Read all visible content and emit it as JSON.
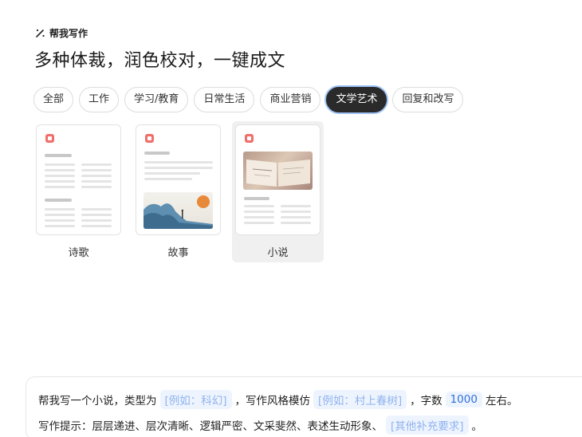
{
  "header": {
    "badge_label": "帮我写作",
    "title": "多种体裁，润色校对，一键成文",
    "badge_icon": "magic-wand-icon"
  },
  "tabs": [
    {
      "label": "全部",
      "active": false
    },
    {
      "label": "工作",
      "active": false
    },
    {
      "label": "学习/教育",
      "active": false
    },
    {
      "label": "日常生活",
      "active": false
    },
    {
      "label": "商业营销",
      "active": false
    },
    {
      "label": "文学艺术",
      "active": true
    },
    {
      "label": "回复和改写",
      "active": false
    }
  ],
  "cards": [
    {
      "label": "诗歌",
      "selected": false
    },
    {
      "label": "故事",
      "selected": false
    },
    {
      "label": "小说",
      "selected": true
    }
  ],
  "prompt": {
    "line1": {
      "t1": "帮我写一个小说，类型为",
      "slot_genre": "[例如：科幻]",
      "t2": "，写作风格模仿",
      "slot_style": "[例如：村上春树]",
      "t3": "，字数",
      "slot_words": "1000",
      "t4": "左右。"
    },
    "line2": {
      "t1": "写作提示：层层递进、层次清晰、逻辑严密、文采斐然、表述生动形象、",
      "slot_extra": "[其他补充要求]",
      "t2": "。"
    }
  },
  "colors": {
    "active_tab_bg": "#2a2a2a",
    "active_tab_ring": "#9fc2f5",
    "slot_bg": "#eef4fe",
    "slot_text": "#8fb3ee",
    "slot_filled_text": "#2f6fde",
    "card_icon": "#f16f6a"
  }
}
